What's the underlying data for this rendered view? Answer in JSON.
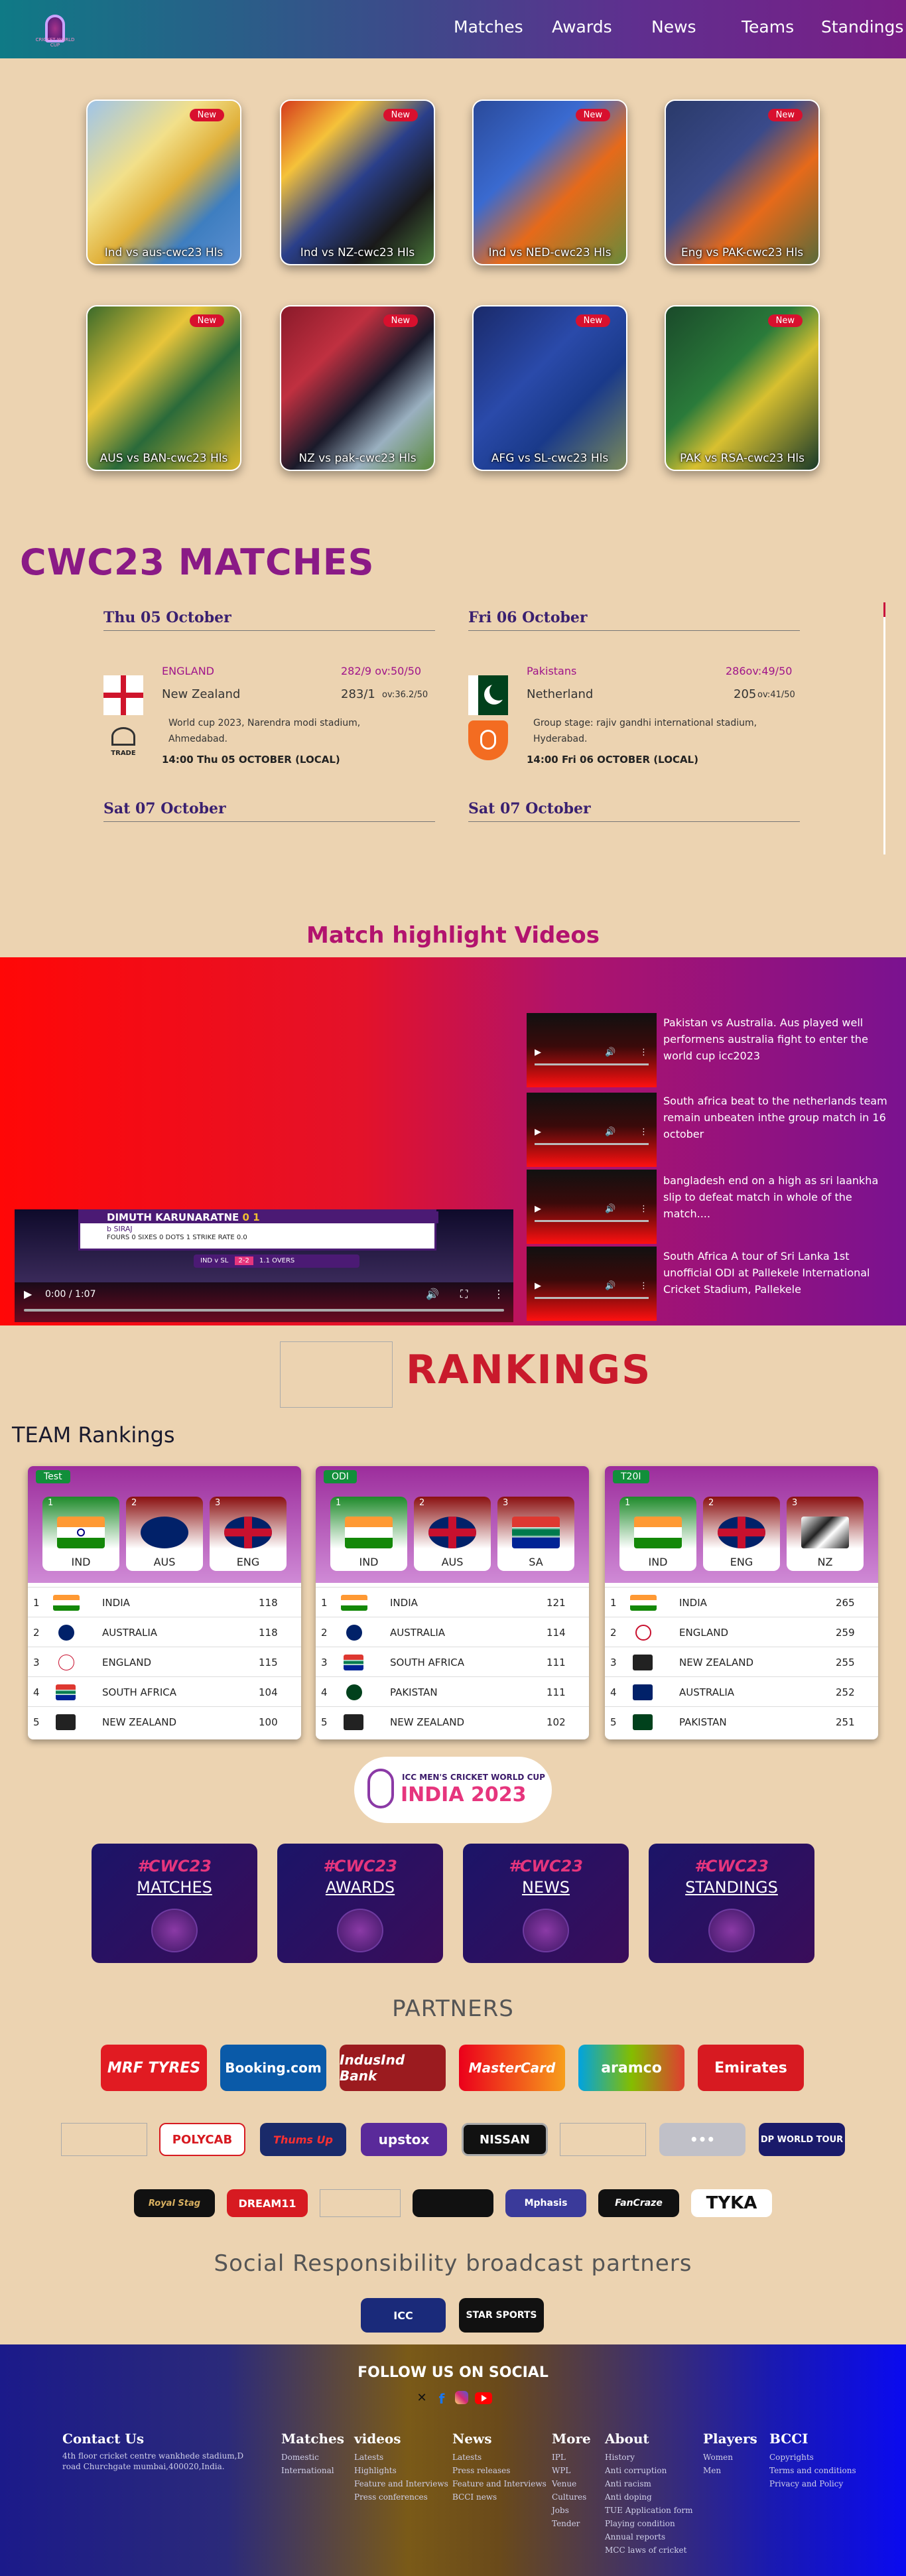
{
  "nav": {
    "logo_text": "CRICKET WORLD CUP",
    "links": [
      "Matches",
      "Awards",
      "News",
      "Teams",
      "Standings"
    ]
  },
  "cards": [
    {
      "title": "Ind vs aus-cwc23 Hls",
      "badge": "New"
    },
    {
      "title": "Ind vs NZ-cwc23 Hls",
      "badge": "New"
    },
    {
      "title": "Ind vs NED-cwc23 Hls",
      "badge": "New"
    },
    {
      "title": "Eng vs PAK-cwc23 Hls",
      "badge": "New"
    },
    {
      "title": "AUS vs BAN-cwc23 Hls",
      "badge": "New"
    },
    {
      "title": "NZ vs pak-cwc23 Hls",
      "badge": "New"
    },
    {
      "title": "AFG vs SL-cwc23 Hls",
      "badge": "New"
    },
    {
      "title": "PAK vs RSA-cwc23 Hls",
      "badge": "New"
    }
  ],
  "matches": {
    "title": "CWC23 MATCHES",
    "days": [
      {
        "date": "Thu 05 October",
        "team1": "ENGLAND",
        "score1": "282/9 ov:50/50",
        "team2": "New Zealand",
        "score2_main": "283/1",
        "score2_overs": "ov:36.2/50",
        "venue": "World cup 2023, Narendra modi stadium, Ahmedabad.",
        "time": "14:00 Thu 05 OCTOBER (LOCAL)"
      },
      {
        "date": "Fri 06 October",
        "team1": "Pakistans",
        "score1": "286ov:49/50",
        "team2": "Netherland",
        "score2_main": "205",
        "score2_overs": "ov:41/50",
        "venue": "Group stage: rajiv gandhi international stadium, Hyderabad.",
        "time": "14:00 Fri 06 OCTOBER (LOCAL)"
      }
    ],
    "next_days": [
      "Sat 07 October",
      "Sat 07 October"
    ],
    "trade_label": "TRADE"
  },
  "videos": {
    "title": "Match highlight Videos",
    "main_time": "0:00 / 1:07",
    "overlay_name": "DIMUTH KARUNARATNE",
    "overlay_runs": "0 1",
    "overlay_bowler": "b SIRAJ",
    "overlay_stats": "FOURS 0   SIXES 0   DOTS 1   STRIKE RATE 0.0",
    "overlay_score": "IND v SL",
    "overlay_total": "2-2",
    "overlay_overs": "1.1 OVERS",
    "list": [
      "Pakistan vs Australia. Aus played well performens australia fight to enter the world cup icc2023",
      "South africa beat to the netherlands team remain unbeaten inthe group match in 16 october",
      "bangladesh end on a high as sri laankha slip to defeat match in whole of the match....",
      "South Africa A tour of Sri Lanka 1st unofficial ODI at Pallekele International Cricket Stadium, Pallekele"
    ]
  },
  "rankings": {
    "title": "RANKINGS",
    "subtitle": "TEAM Rankings",
    "formats": [
      {
        "tag": "Test",
        "top3": [
          "IND",
          "AUS",
          "ENG"
        ],
        "rows": [
          {
            "pos": "1",
            "team": "INDIA",
            "pts": "118"
          },
          {
            "pos": "2",
            "team": "AUSTRALIA",
            "pts": "118"
          },
          {
            "pos": "3",
            "team": "ENGLAND",
            "pts": "115"
          },
          {
            "pos": "4",
            "team": "SOUTH AFRICA",
            "pts": "104"
          },
          {
            "pos": "5",
            "team": "NEW ZEALAND",
            "pts": "100"
          }
        ]
      },
      {
        "tag": "ODI",
        "top3": [
          "IND",
          "AUS",
          "SA"
        ],
        "rows": [
          {
            "pos": "1",
            "team": "INDIA",
            "pts": "121"
          },
          {
            "pos": "2",
            "team": "AUSTRALIA",
            "pts": "114"
          },
          {
            "pos": "3",
            "team": "SOUTH AFRICA",
            "pts": "111"
          },
          {
            "pos": "4",
            "team": "PAKISTAN",
            "pts": "111"
          },
          {
            "pos": "5",
            "team": "NEW ZEALAND",
            "pts": "102"
          }
        ]
      },
      {
        "tag": "T20I",
        "top3": [
          "IND",
          "ENG",
          "NZ"
        ],
        "rows": [
          {
            "pos": "1",
            "team": "INDIA",
            "pts": "265"
          },
          {
            "pos": "2",
            "team": "ENGLAND",
            "pts": "259"
          },
          {
            "pos": "3",
            "team": "NEW ZEALAND",
            "pts": "255"
          },
          {
            "pos": "4",
            "team": "AUSTRALIA",
            "pts": "252"
          },
          {
            "pos": "5",
            "team": "PAKISTAN",
            "pts": "251"
          }
        ]
      }
    ]
  },
  "wc_badge": {
    "line1": "ICC MEN'S CRICKET WORLD CUP",
    "line2": "INDIA 2023"
  },
  "tiles": [
    {
      "tag": "#CWC23",
      "label": "MATCHES"
    },
    {
      "tag": "#CWC23",
      "label": "AWARDS"
    },
    {
      "tag": "#CWC23",
      "label": "NEWS"
    },
    {
      "tag": "#CWC23",
      "label": "STANDINGS"
    }
  ],
  "partners": {
    "title": "PARTNERS",
    "row1": [
      "MRF TYRES",
      "Booking.com",
      "IndusInd Bank",
      "MasterCard",
      "aramco",
      "Emirates"
    ],
    "row2": [
      "POLYCAB",
      "Thums Up",
      "upstox",
      "NISSAN",
      "DP WORLD TOUR"
    ],
    "row3": [
      "Royal Stag",
      "DREAM11",
      "Mphasis",
      "FanCraze",
      "TYKA"
    ]
  },
  "srp": {
    "title": "Social Responsibility broadcast partners",
    "logos": [
      "ICC",
      "STAR SPORTS"
    ]
  },
  "footer": {
    "follow": "FOLLOW US ON SOCIAL",
    "contact_title": "Contact Us",
    "contact_text": "4th floor cricket centre wankhede stadium,D road Churchgate mumbai,400020,India.",
    "cols": [
      {
        "title": "Matches",
        "items": [
          "Domestic",
          "International"
        ]
      },
      {
        "title": "videos",
        "items": [
          "Latests",
          "Highlights",
          "Feature and Interviews",
          "Press conferences"
        ]
      },
      {
        "title": "News",
        "items": [
          "Latests",
          "Press releases",
          "Feature and Interviews",
          "BCCI news"
        ]
      },
      {
        "title": "More",
        "items": [
          "IPL",
          "WPL",
          "Venue",
          "Cultures",
          "Jobs",
          "Tender"
        ]
      },
      {
        "title": "About",
        "items": [
          "History",
          "Anti corruption",
          "Anti racism",
          "Anti doping",
          "TUE Application form",
          "Playing condition",
          "Annual reports",
          "MCC laws of cricket"
        ]
      },
      {
        "title": "Players",
        "items": [
          "Women",
          "Men"
        ]
      },
      {
        "title": "BCCI",
        "items": [
          "Copyrights",
          "Terms and conditions",
          "Privacy and Policy"
        ]
      }
    ]
  },
  "colors": {
    "accent": "#8a1a86",
    "rankings": "#c91a2c",
    "page_bg": "#ecd3b1"
  }
}
